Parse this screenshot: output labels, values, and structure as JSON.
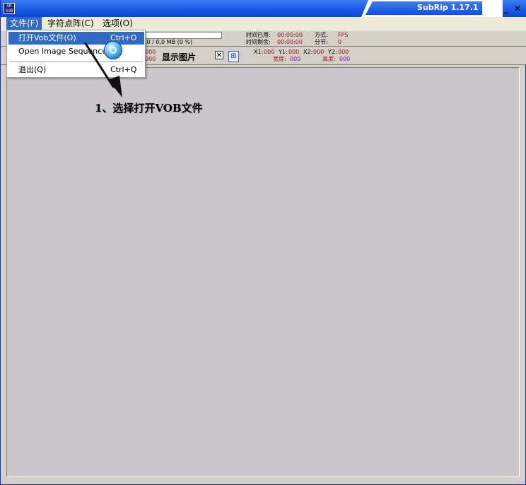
{
  "window": {
    "title": "SubRip 1.17.1",
    "minimize_label": "_",
    "close_label": "✕"
  },
  "menubar": {
    "items": [
      {
        "label": "文件(F)"
      },
      {
        "label": "字符点阵(C)"
      },
      {
        "label": "选项(O)"
      }
    ]
  },
  "file_menu": {
    "items": [
      {
        "label": "打开Vob文件(O)",
        "shortcut": "Ctrl+O"
      },
      {
        "label": "Open Image Sequence",
        "shortcut": ""
      },
      {
        "label": "退出(Q)",
        "shortcut": "Ctrl+Q"
      }
    ]
  },
  "status": {
    "size": ",0 / 0,0 MB (0 %)",
    "time_used_label": "时间已用:",
    "time_used": "00:00:00",
    "time_left_label": "时间剩余:",
    "time_left": "00:00:00",
    "mode_label": "方式:",
    "mode": "FPS",
    "chapter_label": "分节:",
    "chapter": "0"
  },
  "toolbar2": {
    "val1": "000",
    "val2": "000",
    "show_image": "显示图片",
    "close_btn": "✕",
    "image_btn": "⊞",
    "x1_label": "X1:",
    "x1": "000",
    "y1_label": "Y1:",
    "y1": "000",
    "x2_label": "X2:",
    "x2": "000",
    "y2_label": "Y2:",
    "y2": "000",
    "width_label": "宽度:",
    "width": "000",
    "height_label": "高度:",
    "height": "000"
  },
  "annotation": {
    "text": "1、选择打开VOB文件"
  },
  "colors": {
    "title_blue": "#1b5fe8",
    "menu_highlight": "#316ac5",
    "label_red": "#8b1a1a",
    "value_blue": "#1a2aa0",
    "value_purple": "#7a1ab8"
  }
}
